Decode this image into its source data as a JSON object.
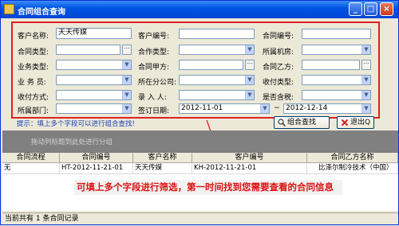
{
  "window": {
    "title": "合同组合查询",
    "min": "_",
    "max": "□",
    "close": "×"
  },
  "form": {
    "r1": {
      "l1": "客户名称:",
      "v1": "天天传媒",
      "l2": "客户编号:",
      "v2": "",
      "l3": "合同编号:",
      "v3": ""
    },
    "r2": {
      "l1": "合同类型:",
      "v1": "",
      "l2": "合作类型:",
      "v2": "",
      "l3": "所属机房:",
      "v3": ""
    },
    "r3": {
      "l1": "业务类型:",
      "v1": "",
      "l2": "合同甲方:",
      "v2": "",
      "l3": "合同乙方:",
      "v3": ""
    },
    "r4": {
      "l1": "业 务 员:",
      "v1": "",
      "l2": "所在分公司:",
      "v2": "",
      "l3": "收付类型:",
      "v3": ""
    },
    "r5": {
      "l1": "收付方式:",
      "v1": "",
      "l2": "录 入 人:",
      "v2": "",
      "l3": "是否含税:",
      "v3": ""
    },
    "r6": {
      "l1": "所属部门:",
      "v1": "",
      "l2": "签订日期:",
      "date_from": "2012-11-01",
      "tilde": "~",
      "date_to": "2012-12-14"
    }
  },
  "hint": "提示：填上多个字段可以进行组合查找!",
  "buttons": {
    "search": "组合查找",
    "exit": "退出Q"
  },
  "group_bar": "拖动列标题到此处进行分组",
  "table": {
    "headers": [
      "合同流程",
      "合同编号",
      "客户名称",
      "客户编号",
      "合同乙方名称"
    ],
    "rows": [
      [
        "无",
        "HT-2012-11-21-01",
        "天天传媒",
        "KH-2012-11-21-01",
        "比泽尔制冷技术（中国）"
      ]
    ]
  },
  "annotation": "可填上多个字段进行筛选，第一时间找到您需要查看的合同信息",
  "status": "当前共有 1 条合同记录",
  "colors": {
    "title_bar": "#0055e5",
    "annotation_red": "#e01010",
    "hint_blue": "#1a3fb0"
  }
}
